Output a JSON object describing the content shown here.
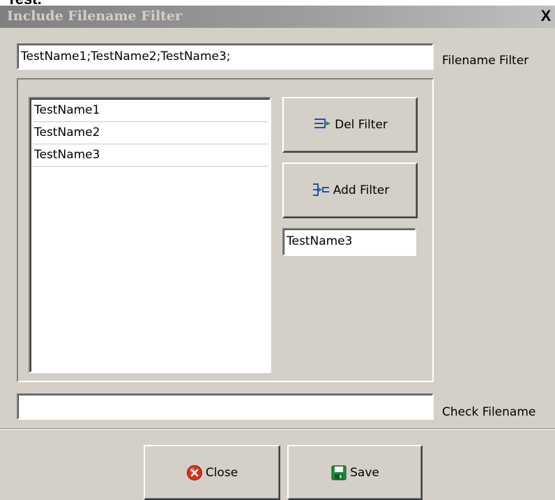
{
  "page_header": {
    "text": "Test."
  },
  "window": {
    "title": "Include Filename Filter",
    "close_glyph": "X"
  },
  "filename_filter": {
    "value": "TestName1;TestName2;TestName3;",
    "label": "Filename Filter"
  },
  "filter_list": {
    "items": [
      "TestName1",
      "TestName2",
      "TestName3"
    ]
  },
  "buttons": {
    "del_filter": {
      "label": "Del Filter",
      "icon": "del-filter-icon"
    },
    "add_filter": {
      "label": "Add Filter",
      "icon": "add-filter-icon"
    },
    "close": {
      "label": "Close",
      "icon": "close-circle-icon"
    },
    "save": {
      "label": "Save",
      "icon": "floppy-disk-icon"
    }
  },
  "filter_entry": {
    "value": "TestName3"
  },
  "check_filename": {
    "value": "",
    "label": "Check Filename"
  },
  "colors": {
    "face": "#d4d0c8",
    "icon_blue": "#1f4fbf",
    "close_red": "#d8301c",
    "save_green": "#1c8c3c"
  }
}
